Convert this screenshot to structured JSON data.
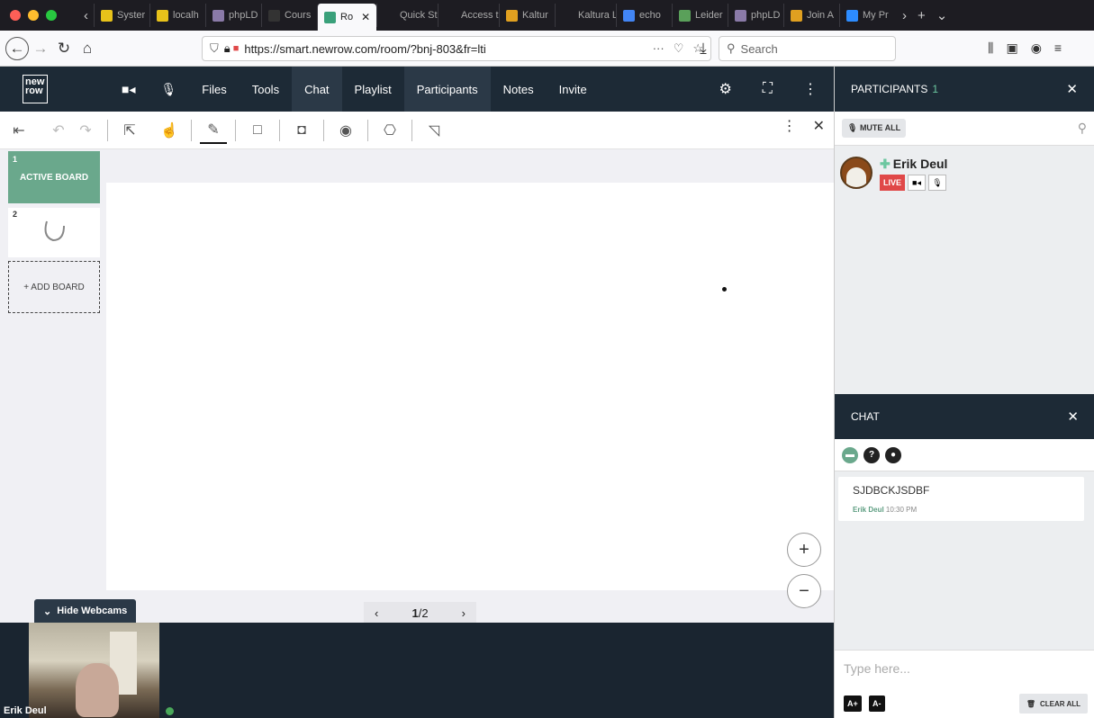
{
  "browser": {
    "tabs": [
      {
        "label": "Syster",
        "fav_color": "#e8c21a",
        "active": false
      },
      {
        "label": "localh",
        "fav_color": "#e8c21a",
        "active": false
      },
      {
        "label": "phpLD",
        "fav_color": "#8a7aa8",
        "active": false
      },
      {
        "label": "Cours",
        "fav_color": "#333333",
        "active": false
      },
      {
        "label": "Ro",
        "fav_color": "#3aa07a",
        "active": true
      },
      {
        "label": "Quick Star",
        "fav_color": "",
        "active": false
      },
      {
        "label": "Access to",
        "fav_color": "",
        "active": false
      },
      {
        "label": "Kaltur",
        "fav_color": "#e0a020",
        "active": false
      },
      {
        "label": "Kaltura Liv",
        "fav_color": "",
        "active": false
      },
      {
        "label": "echo",
        "fav_color": "#4285f4",
        "active": false
      },
      {
        "label": "Leider",
        "fav_color": "#5aa05a",
        "active": false
      },
      {
        "label": "phpLD",
        "fav_color": "#8a7aa8",
        "active": false
      },
      {
        "label": "Join A",
        "fav_color": "#e0a020",
        "active": false
      },
      {
        "label": "My Pr",
        "fav_color": "#2d8cff",
        "active": false
      }
    ],
    "url": "https://smart.newrow.com/room/?bnj-803&fr=lti",
    "search_placeholder": "Search"
  },
  "app": {
    "logo": "new row",
    "menu": [
      {
        "label": "Files"
      },
      {
        "label": "Tools"
      },
      {
        "label": "Chat"
      },
      {
        "label": "Playlist"
      },
      {
        "label": "Participants"
      },
      {
        "label": "Notes"
      },
      {
        "label": "Invite"
      }
    ]
  },
  "participants": {
    "title": "PARTICIPANTS",
    "count": "1",
    "mute_all": "MUTE ALL",
    "list": [
      {
        "name": "Erik Deul",
        "status": "LIVE"
      }
    ]
  },
  "chat": {
    "title": "CHAT",
    "messages": [
      {
        "text": "SJDBCKJSDBF",
        "author": "Erik Deul",
        "time": "10:30 PM"
      }
    ],
    "input_placeholder": "Type here...",
    "font_up": "A+",
    "font_down": "A-",
    "clear_all": "CLEAR ALL"
  },
  "boards": {
    "items": [
      {
        "number": "1",
        "label": "ACTIVE BOARD"
      },
      {
        "number": "2",
        "label": ""
      }
    ],
    "add_label": "+ ADD BOARD"
  },
  "pager": {
    "current": "1",
    "total": "2"
  },
  "webcams": {
    "hide_label": "Hide Webcams",
    "cams": [
      {
        "name": "Erik Deul"
      }
    ]
  },
  "colors": {
    "accent": "#6aa88c",
    "dark": "#1d2a36",
    "live": "#e04848"
  }
}
